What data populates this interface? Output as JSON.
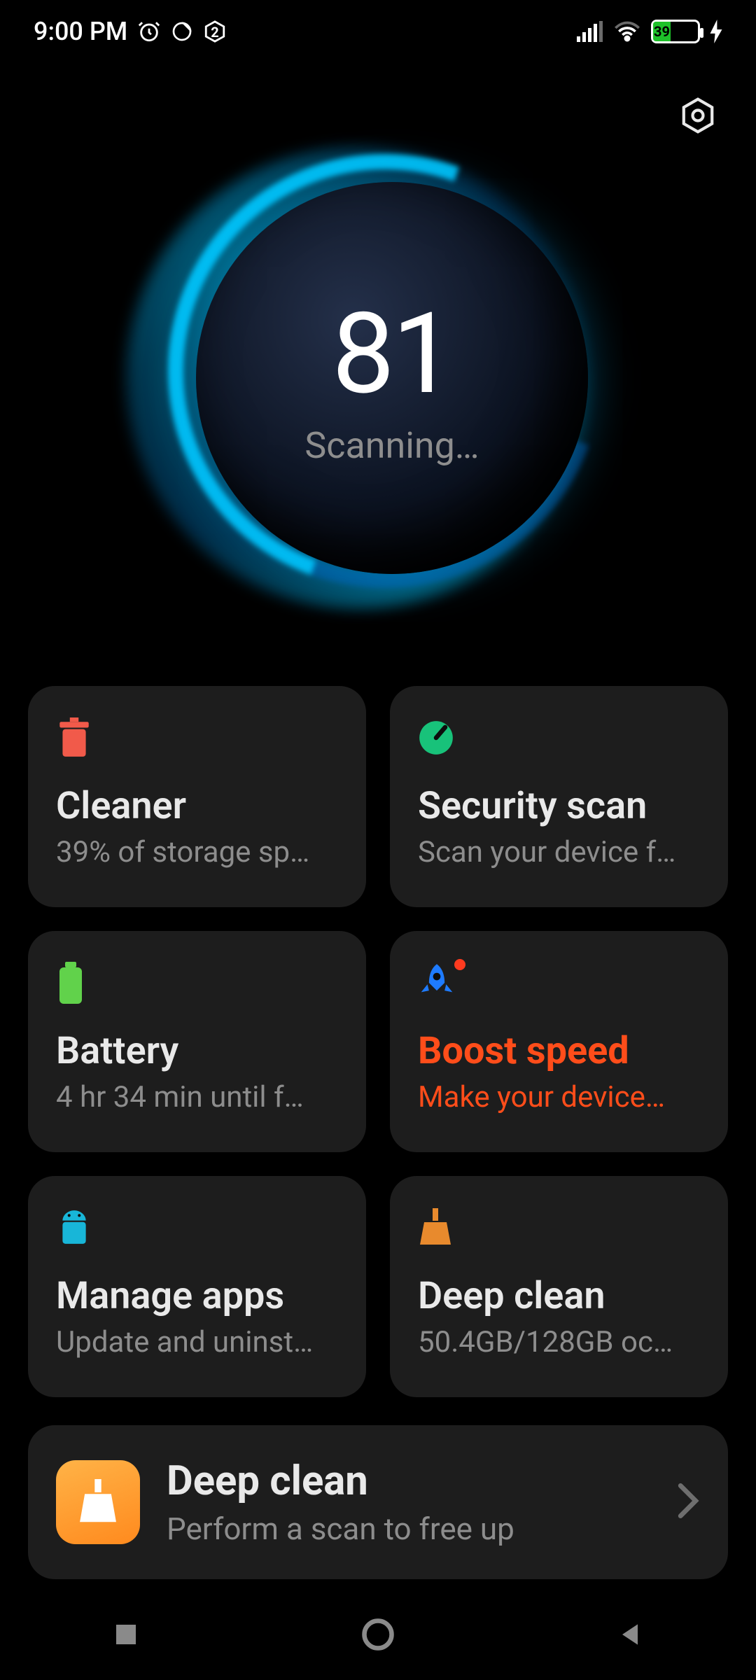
{
  "statusbar": {
    "time": "9:00 PM",
    "battery_percent": "39",
    "notification_count": "2"
  },
  "security": {
    "score": "81",
    "status_text": "Scanning…"
  },
  "cards": {
    "cleaner": {
      "title": "Cleaner",
      "subtitle": "39% of storage sp…"
    },
    "securityscan": {
      "title": "Security scan",
      "subtitle": "Scan your device f…"
    },
    "battery": {
      "title": "Battery",
      "subtitle": "4 hr 34 min  until f…"
    },
    "boost": {
      "title": "Boost speed",
      "subtitle": "Make your device…"
    },
    "manageapps": {
      "title": "Manage apps",
      "subtitle": "Update and uninst…"
    },
    "deepclean": {
      "title": "Deep clean",
      "subtitle": "50.4GB/128GB oc…"
    }
  },
  "promo": {
    "title": "Deep clean",
    "subtitle": "Perform a scan to free up"
  },
  "colors": {
    "accent_orange": "#ff4d1a",
    "card_bg": "#1d1d1d",
    "icon_cleaner": "#f15a4a",
    "icon_security": "#18c27a",
    "icon_battery": "#61d24b",
    "icon_boost": "#1e7bff",
    "icon_apps": "#18b6d8",
    "icon_deep": "#e88a2d"
  }
}
